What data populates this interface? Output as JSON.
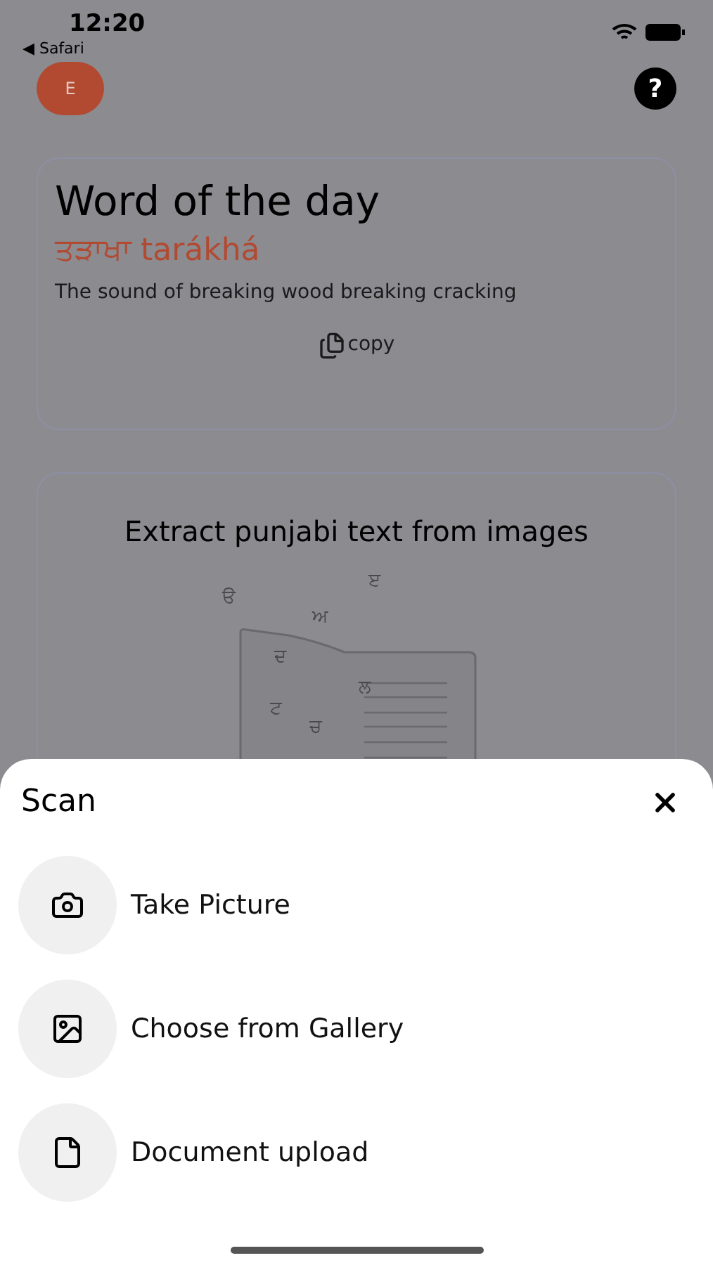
{
  "status_bar": {
    "time": "12:20",
    "back_app": "◀ Safari"
  },
  "header": {
    "avatar": "E",
    "help": "?"
  },
  "word_card": {
    "title": "Word of the day",
    "word": "ਤੜਾਖਾ tarákhá",
    "meaning": "The sound of breaking wood breaking cracking",
    "copy": "copy"
  },
  "extract_card": {
    "title": "Extract punjabi text from images",
    "letters": [
      "ੳ",
      "ੲ",
      "ਅ",
      "ਦ",
      "ਲ",
      "ਟ",
      "ਚ"
    ]
  },
  "sheet": {
    "title": "Scan",
    "options": [
      {
        "kind": "camera",
        "label": "Take Picture"
      },
      {
        "kind": "gallery",
        "label": "Choose from Gallery"
      },
      {
        "kind": "document",
        "label": "Document upload"
      }
    ]
  }
}
